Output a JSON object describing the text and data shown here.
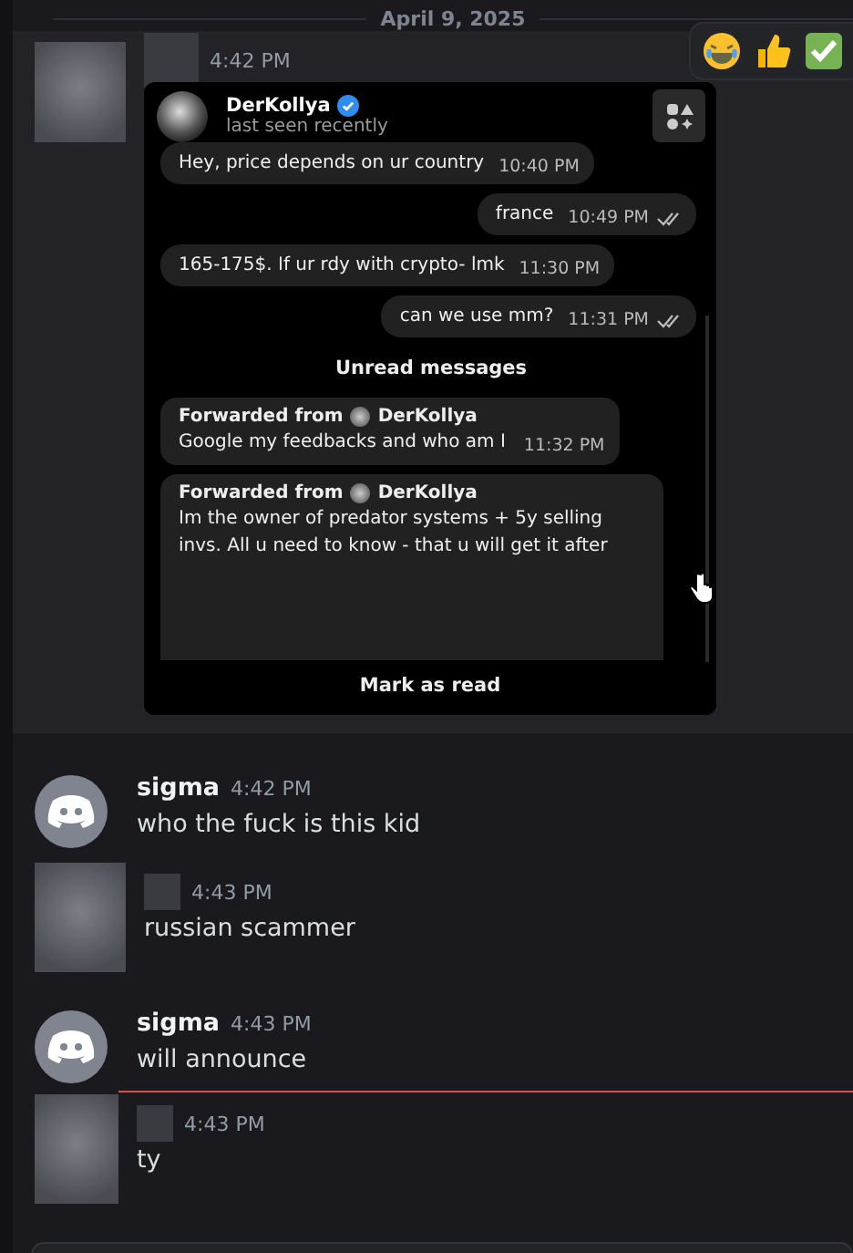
{
  "date_divider": "April 9, 2025",
  "messages": [
    {
      "kind": "redacted",
      "time": "4:42 PM",
      "unread_marker": false,
      "embed": {
        "contact": {
          "name": "DerKollya",
          "verified": true,
          "status": "last seen recently"
        },
        "messages": [
          {
            "kind": "incoming",
            "text": "Hey, price depends on ur country",
            "time": "10:40 PM"
          },
          {
            "kind": "outgoing",
            "text": "france",
            "time": "10:49 PM",
            "read": true
          },
          {
            "kind": "incoming",
            "text": "165-175$. If ur rdy with crypto- lmk",
            "time": "11:30 PM"
          },
          {
            "kind": "outgoing",
            "text": "can we use mm?",
            "time": "11:31 PM",
            "read": true
          },
          {
            "kind": "divider",
            "text": "Unread messages"
          },
          {
            "kind": "forwarded",
            "label": "Forwarded from",
            "from": "DerKollya",
            "text": "Google my feedbacks and who am I",
            "time": "11:32 PM"
          },
          {
            "kind": "forwarded",
            "label": "Forwarded from",
            "from": "DerKollya",
            "text": "Im the owner of predator systems + 5y selling invs. All u need to know - that u will get it after"
          }
        ],
        "footer_button": "Mark as read"
      }
    },
    {
      "kind": "user",
      "author": "sigma",
      "time": "4:42 PM",
      "text": "who the fuck is this kid",
      "unread_marker": false
    },
    {
      "kind": "redacted",
      "time": "4:43 PM",
      "text": "russian scammer",
      "unread_marker": false
    },
    {
      "kind": "user",
      "author": "sigma",
      "time": "4:43 PM",
      "text": "will announce",
      "unread_marker": false
    },
    {
      "kind": "redacted",
      "time": "4:43 PM",
      "text": "ty",
      "unread_marker": true
    }
  ]
}
